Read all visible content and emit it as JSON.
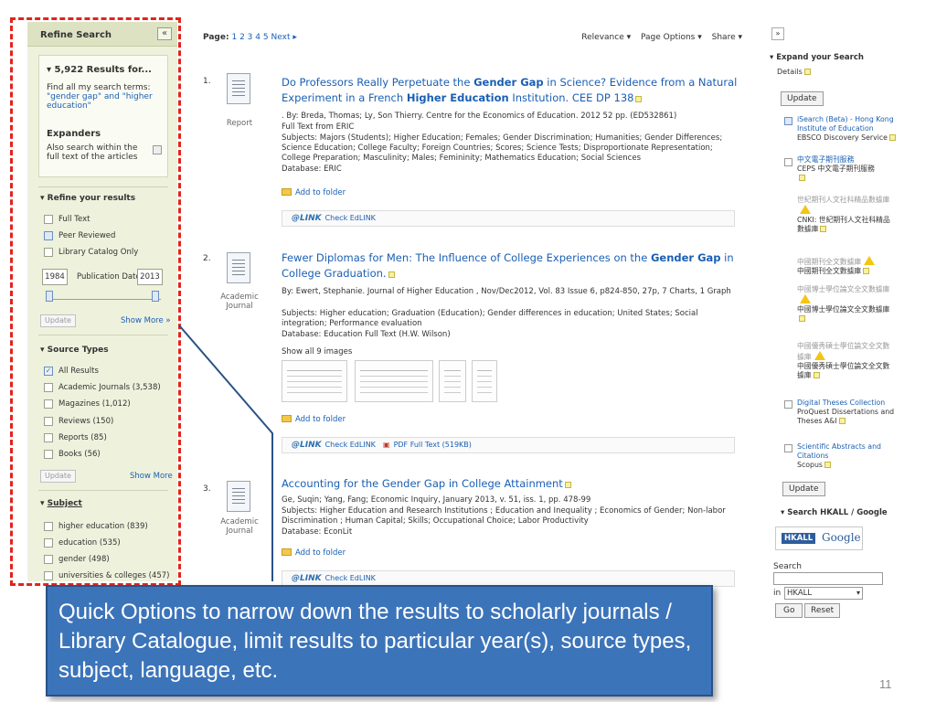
{
  "sidebar": {
    "title": "Refine Search",
    "collapse_label": "«",
    "results_heading": "5,922 Results for...",
    "find_all": "Find all my search terms:",
    "search_terms": "\"gender gap\" and \"higher education\"",
    "expanders_heading": "Expanders",
    "expanders_text": "Also search within the full text of the articles",
    "refine_heading": "Refine your results",
    "limiters": [
      {
        "label": "Full Text",
        "checked": false
      },
      {
        "label": "Peer Reviewed",
        "checked": false
      },
      {
        "label": "Library Catalog Only",
        "checked": false
      }
    ],
    "date_from": "1984",
    "date_label": "Publication Date",
    "date_to": "2013",
    "update_label": "Update",
    "show_more_label": "Show More »",
    "source_types_heading": "Source Types",
    "source_types": [
      {
        "label": "All Results",
        "checked": true
      },
      {
        "label": "Academic Journals (3,538)",
        "checked": false
      },
      {
        "label": "Magazines (1,012)",
        "checked": false
      },
      {
        "label": "Reviews (150)",
        "checked": false
      },
      {
        "label": "Reports (85)",
        "checked": false
      },
      {
        "label": "Books (56)",
        "checked": false
      }
    ],
    "update2_label": "Update",
    "show_more2_label": "Show More",
    "subject_heading": "Subject",
    "subjects": [
      {
        "label": "higher education (839)"
      },
      {
        "label": "education (535)"
      },
      {
        "label": "gender (498)"
      },
      {
        "label": "universities & colleges (457)"
      }
    ]
  },
  "main": {
    "page_label": "Page:",
    "pages": [
      "1",
      "2",
      "3",
      "4",
      "5"
    ],
    "next_label": "Next ▸",
    "relevance": "Relevance ▾",
    "page_options": "Page Options ▾",
    "share": "Share ▾",
    "records": [
      {
        "num": "1.",
        "type": "Report",
        "title_parts": [
          "Do Professors Really Perpetuate the ",
          "Gender Gap",
          " in Science? Evidence from a Natural Experiment in a French ",
          "Higher Education",
          " Institution. CEE DP 138"
        ],
        "byline": ". By: Breda, Thomas; Ly, Son Thierry. Centre for the Economics of Education. 2012 52 pp. (ED532861)",
        "fulltext": "Full Text from ERIC",
        "subjects": "Subjects: Majors (Students); Higher Education; Females; Gender Discrimination; Humanities; Gender Differences; Science Education; College Faculty; Foreign Countries; Scores; Science Tests; Disproportionate Representation; College Preparation; Masculinity; Males; Femininity; Mathematics Education; Social Sciences",
        "database": "Database: ERIC",
        "add_folder": "Add to folder",
        "edlink": "Check EdLINK"
      },
      {
        "num": "2.",
        "type": "Academic Journal",
        "title_parts": [
          "Fewer Diplomas for Men: The Influence of College Experiences on the ",
          "Gender Gap",
          " in College Graduation."
        ],
        "byline": "By: Ewert, Stephanie. Journal of Higher Education , Nov/Dec2012, Vol. 83 Issue 6, p824-850, 27p, 7 Charts, 1 Graph",
        "subjects": "Subjects: Higher education; Graduation (Education); Gender differences in education; United States; Social integration; Performance evaluation",
        "database": "Database: Education Full Text (H.W. Wilson)",
        "show_images": "Show all 9 images",
        "add_folder": "Add to folder",
        "edlink": "Check EdLINK",
        "pdf": "PDF Full Text (519KB)"
      },
      {
        "num": "3.",
        "type": "Academic Journal",
        "title_parts": [
          "Accounting for the Gender Gap in College Attainment"
        ],
        "byline": "Ge, Suqin; Yang, Fang; Economic Inquiry, January 2013, v. 51, iss. 1, pp. 478-99",
        "subjects": "Subjects: Higher Education and Research Institutions ; Education and Inequality ; Economics of Gender; Non-labor Discrimination ; Human Capital; Skills; Occupational Choice; Labor Productivity",
        "database": "Database: EconLit",
        "add_folder": "Add to folder",
        "edlink": "Check EdLINK"
      }
    ]
  },
  "rightbar": {
    "expand_label": "»",
    "expand_heading": "Expand your Search",
    "details": "Details",
    "update_label": "Update",
    "items": [
      {
        "name": "iSearch (Beta) - Hong Kong Institute of Education",
        "sub": "EBSCO Discovery Service",
        "checked": true
      },
      {
        "name": "中文電子期刊服務",
        "sub": "CEPS 中文電子期刊服務",
        "checked": false
      },
      {
        "grey": "世紀期刊人文社科精品數據庫",
        "sub": "CNKI: 世紀期刊人文社科精品數據庫"
      },
      {
        "grey": "中國期刊全文數據庫",
        "sub": "中國期刊全文數據庫"
      },
      {
        "grey": "中國博士學位論文全文數據庫",
        "sub": "中國博士學位論文全文數據庫"
      },
      {
        "grey": "中國優秀碩士學位論文全文數據庫",
        "sub": "中國優秀碩士學位論文全文數據庫"
      },
      {
        "name": "Digital Theses Collection",
        "sub": "ProQuest Dissertations and Theses A&I",
        "checked": false
      },
      {
        "name": "Scientific Abstracts and Citations",
        "sub": "Scopus",
        "checked": false
      }
    ],
    "update2_label": "Update",
    "search_heading": "Search HKALL / Google",
    "hkall": "HKALL",
    "google": "Google",
    "search_label": "Search",
    "in_label": "in",
    "in_value": "HKALL",
    "go_label": "Go",
    "reset_label": "Reset"
  },
  "callout": {
    "text": "Quick Options to narrow down the results to scholarly journals / Library Catalogue, limit results to particular year(s), source types, subject, language, etc."
  },
  "slide_number": "11"
}
